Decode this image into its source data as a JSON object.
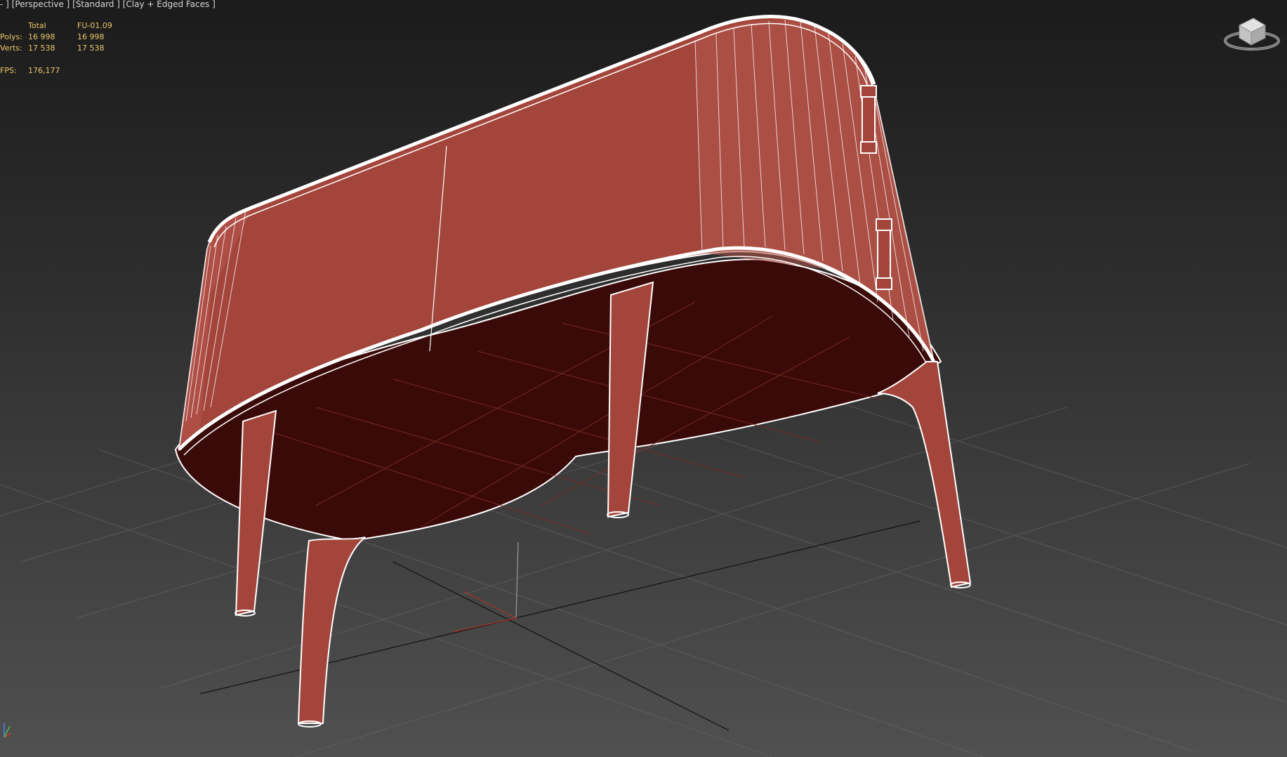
{
  "viewport": {
    "label": "- ] [Perspective ] [Standard ] [Clay + Edged Faces ]",
    "background_top": "#1b1b1b",
    "background_bottom": "#505050"
  },
  "stats": {
    "header": {
      "label": "",
      "total": "Total",
      "object": "FU-01.09"
    },
    "polys": {
      "label": "Polys:",
      "total": "16 998",
      "object": "16 998"
    },
    "verts": {
      "label": "Verts:",
      "total": "17 538",
      "object": "17 538"
    },
    "fps": {
      "label": "FPS:",
      "value": "176,177"
    },
    "text_color": "#e8c86a"
  },
  "model": {
    "name": "sideboard-wireframe",
    "clay_color": "#a3453b",
    "shadow_color": "#3a0a08",
    "wire_color": "#ffffff"
  },
  "icons": {
    "viewcube": "viewcube-icon",
    "axis": "axis-tripod-icon"
  }
}
